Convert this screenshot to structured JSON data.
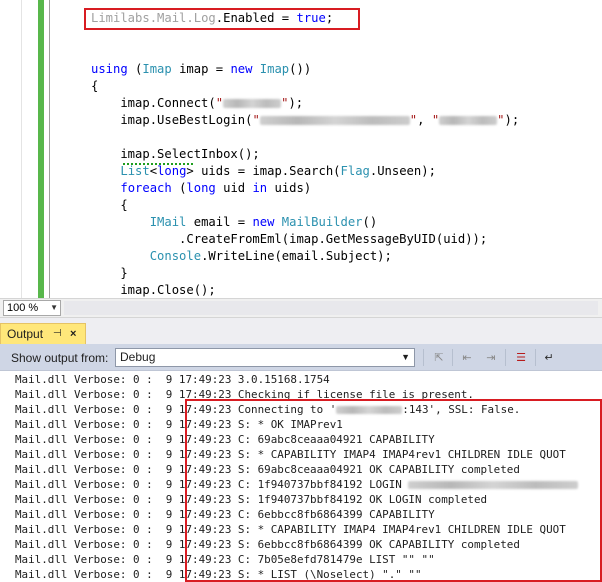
{
  "editor": {
    "lines": [
      {
        "segments": [
          [
            "gray",
            "Limilabs."
          ],
          [
            "gray",
            "Mail"
          ],
          [
            "gray",
            "."
          ],
          [
            "gray",
            "Log"
          ],
          [
            "plain",
            ".Enabled = "
          ],
          [
            "kw",
            "true"
          ],
          [
            "plain",
            ";"
          ]
        ]
      },
      {
        "segments": []
      },
      {
        "segments": [
          [
            "kw",
            "using"
          ],
          [
            "plain",
            " ("
          ],
          [
            "ty",
            "Imap"
          ],
          [
            "plain",
            " imap = "
          ],
          [
            "kw",
            "new"
          ],
          [
            "plain",
            " "
          ],
          [
            "ty",
            "Imap"
          ],
          [
            "plain",
            "())"
          ]
        ]
      },
      {
        "segments": [
          [
            "plain",
            "{"
          ]
        ]
      },
      {
        "segments": [
          [
            "plain",
            "    imap.Connect("
          ],
          [
            "str",
            "\""
          ],
          [
            "blur",
            ""
          ],
          [
            "str",
            "\""
          ],
          [
            "plain",
            ");"
          ]
        ]
      },
      {
        "segments": [
          [
            "plain",
            "    imap.UseBestLogin("
          ],
          [
            "str",
            "\""
          ],
          [
            "blurwide",
            ""
          ],
          [
            "str",
            "\""
          ],
          [
            "plain",
            ", "
          ],
          [
            "str",
            "\""
          ],
          [
            "blur",
            ""
          ],
          [
            "str",
            "\""
          ],
          [
            "plain",
            ");"
          ]
        ]
      },
      {
        "segments": []
      },
      {
        "segments": [
          [
            "plain",
            "    imap.SelectInbox();"
          ]
        ]
      },
      {
        "segments": [
          [
            "plain",
            "    "
          ],
          [
            "ty",
            "List"
          ],
          [
            "plain",
            "<"
          ],
          [
            "kw",
            "long"
          ],
          [
            "plain",
            "> uids = imap.Search("
          ],
          [
            "ty",
            "Flag"
          ],
          [
            "plain",
            ".Unseen);"
          ]
        ]
      },
      {
        "segments": [
          [
            "plain",
            "    "
          ],
          [
            "kw",
            "foreach"
          ],
          [
            "plain",
            " ("
          ],
          [
            "kw",
            "long"
          ],
          [
            "plain",
            " uid "
          ],
          [
            "kw",
            "in"
          ],
          [
            "plain",
            " uids)"
          ]
        ]
      },
      {
        "segments": [
          [
            "plain",
            "    {"
          ]
        ]
      },
      {
        "segments": [
          [
            "plain",
            "        "
          ],
          [
            "ty",
            "IMail"
          ],
          [
            "plain",
            " email = "
          ],
          [
            "kw",
            "new"
          ],
          [
            "plain",
            " "
          ],
          [
            "ty",
            "MailBuilder"
          ],
          [
            "plain",
            "()"
          ]
        ]
      },
      {
        "segments": [
          [
            "plain",
            "            .CreateFromEml(imap.GetMessageByUID(uid));"
          ]
        ]
      },
      {
        "segments": [
          [
            "plain",
            "        "
          ],
          [
            "ty",
            "Console"
          ],
          [
            "plain",
            ".WriteLine(email.Subject);"
          ]
        ]
      },
      {
        "segments": [
          [
            "plain",
            "    }"
          ]
        ]
      },
      {
        "segments": [
          [
            "plain",
            "    imap.Close();"
          ]
        ]
      },
      {
        "segments": [
          [
            "plain",
            "}"
          ]
        ]
      }
    ]
  },
  "zoom": {
    "value": "100 %"
  },
  "output": {
    "tab_label": "Output",
    "show_from_label": "Show output from:",
    "source_value": "Debug",
    "lines": [
      {
        "prefix": "Mail.dll Verbose: 0 :  9 ",
        "text": "17:49:23 3.0.15168.1754"
      },
      {
        "prefix": "Mail.dll Verbose: 0 :  9 ",
        "text": "17:49:23 Checking if license file is present."
      },
      {
        "prefix": "Mail.dll Verbose: 0 :  9 ",
        "text": "17:49:23 Connecting to '",
        "blur": true,
        "after": ":143', SSL: False."
      },
      {
        "prefix": "Mail.dll Verbose: 0 :  9 ",
        "text": "17:49:23 S: * OK IMAPrev1"
      },
      {
        "prefix": "Mail.dll Verbose: 0 :  9 ",
        "text": "17:49:23 C: 69abc8ceaaa04921 CAPABILITY"
      },
      {
        "prefix": "Mail.dll Verbose: 0 :  9 ",
        "text": "17:49:23 S: * CAPABILITY IMAP4 IMAP4rev1 CHILDREN IDLE QUOT"
      },
      {
        "prefix": "Mail.dll Verbose: 0 :  9 ",
        "text": "17:49:23 S: 69abc8ceaaa04921 OK CAPABILITY completed"
      },
      {
        "prefix": "Mail.dll Verbose: 0 :  9 ",
        "text": "17:49:23 C: 1f940737bbf84192 LOGIN ",
        "blur": true,
        "after": ""
      },
      {
        "prefix": "Mail.dll Verbose: 0 :  9 ",
        "text": "17:49:23 S: 1f940737bbf84192 OK LOGIN completed"
      },
      {
        "prefix": "Mail.dll Verbose: 0 :  9 ",
        "text": "17:49:23 C: 6ebbcc8fb6864399 CAPABILITY"
      },
      {
        "prefix": "Mail.dll Verbose: 0 :  9 ",
        "text": "17:49:23 S: * CAPABILITY IMAP4 IMAP4rev1 CHILDREN IDLE QUOT"
      },
      {
        "prefix": "Mail.dll Verbose: 0 :  9 ",
        "text": "17:49:23 S: 6ebbcc8fb6864399 OK CAPABILITY completed"
      },
      {
        "prefix": "Mail.dll Verbose: 0 :  9 ",
        "text": "17:49:23 C: 7b05e8efd781479e LIST \"\" \"\""
      },
      {
        "prefix": "Mail.dll Verbose: 0 :  9 ",
        "text": "17:49:23 S: * LIST (\\Noselect) \".\" \"\""
      }
    ]
  },
  "colors": {
    "highlight_box": "#d81c22",
    "change_bar": "#58b74b",
    "keyword": "#0000ff",
    "type": "#2b91af",
    "active_tab": "#ffe77a"
  }
}
